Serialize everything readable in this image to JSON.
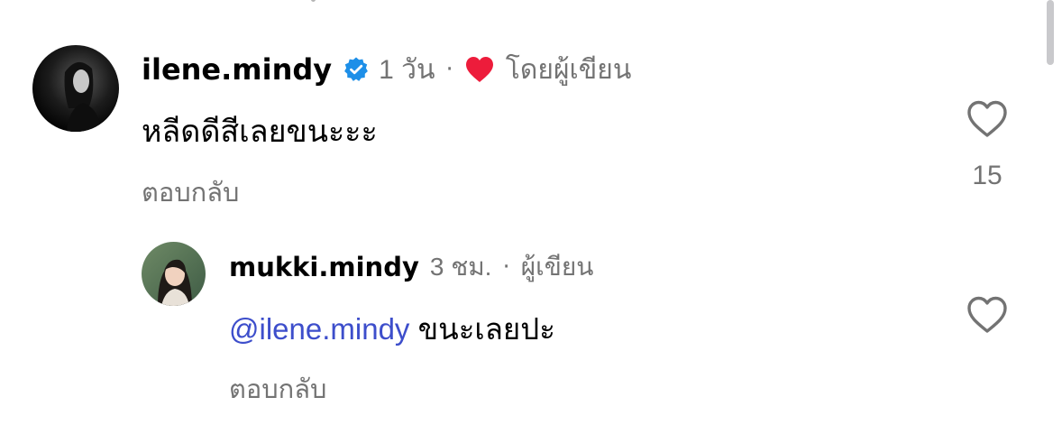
{
  "comment": {
    "username": "ilene.mindy",
    "verified": true,
    "time": "1 วัน",
    "separator": "·",
    "liked_by_author_label": "โดยผู้เขียน",
    "text": "หลีดดีสีเลยขนะะะ",
    "reply_label": "ตอบกลับ",
    "like_count": "15"
  },
  "reply": {
    "username": "mukki.mindy",
    "time": "3 ชม.",
    "separator": "·",
    "author_label": "ผู้เขียน",
    "mention": "@ilene.mindy",
    "text": " ขนะเลยปะ",
    "reply_label": "ตอบกลับ"
  },
  "colors": {
    "text": "#000000",
    "secondary_text": "#737373",
    "mention": "#3d4ecb",
    "verified_badge": "#1d8fe8",
    "liked_heart": "#ed1c3b"
  },
  "icons": {
    "verified": "verified-badge-icon",
    "author_like": "heart-filled-icon",
    "like": "heart-outline-icon"
  }
}
